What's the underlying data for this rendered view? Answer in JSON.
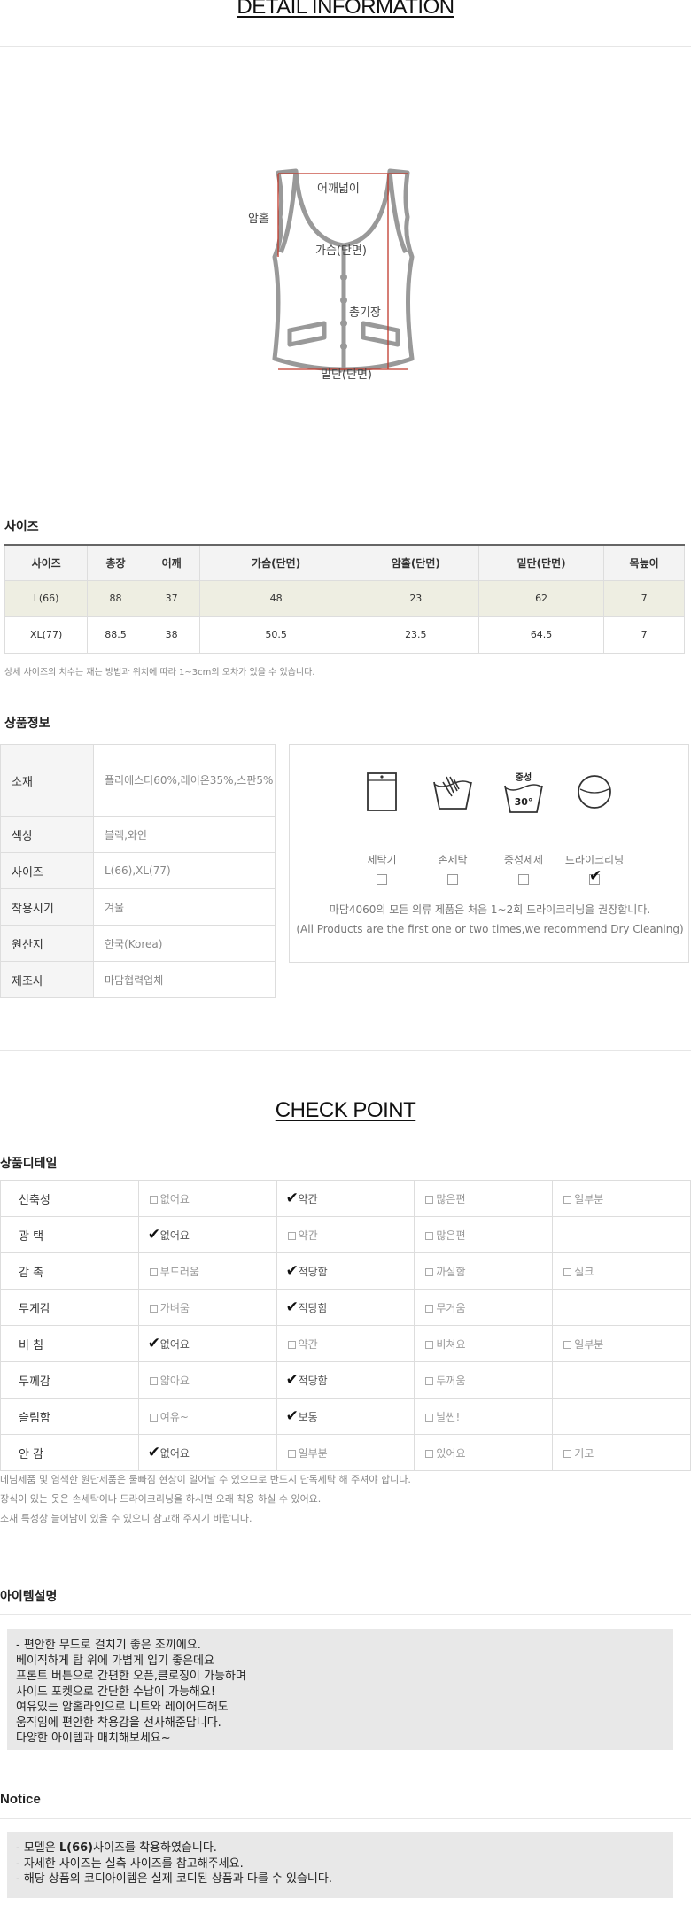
{
  "detail": {
    "title": "DETAIL INFORMATION",
    "diagram_labels": {
      "shoulder": "어깨넓이",
      "armhole": "암홀",
      "chest": "가슴(단면)",
      "length": "총기장",
      "hem": "밑단(단면)"
    }
  },
  "size": {
    "heading": "사이즈",
    "columns": [
      "사이즈",
      "총장",
      "어깨",
      "가슴(단면)",
      "암홀(단면)",
      "밑단(단면)",
      "목높이"
    ],
    "rows": [
      [
        "L(66)",
        "88",
        "37",
        "48",
        "23",
        "62",
        "7"
      ],
      [
        "XL(77)",
        "88.5",
        "38",
        "50.5",
        "23.5",
        "64.5",
        "7"
      ]
    ],
    "note": "상세 사이즈의 치수는 재는 방법과 위치에 따라 1~3cm의 오차가 있을 수 있습니다."
  },
  "product_info": {
    "heading": "상품정보",
    "rows": [
      {
        "key": "소재",
        "value": "폴리에스터60%,레이온35%,스판5%"
      },
      {
        "key": "색상",
        "value": "블랙,와인"
      },
      {
        "key": "사이즈",
        "value": "L(66),XL(77)"
      },
      {
        "key": "착용시기",
        "value": "겨울"
      },
      {
        "key": "원산지",
        "value": "한국(Korea)"
      },
      {
        "key": "제조사",
        "value": "마담협력업체"
      }
    ]
  },
  "care": {
    "items": [
      {
        "label": "세탁기",
        "icon": "washing-machine-icon",
        "checked": false
      },
      {
        "label": "손세탁",
        "icon": "hand-wash-icon",
        "checked": false
      },
      {
        "label": "중성세제",
        "icon": "neutral-detergent-icon",
        "badge_top": "중성",
        "badge_bottom": "30°",
        "checked": false
      },
      {
        "label": "드라이크리닝",
        "icon": "dry-cleaning-icon",
        "checked": true
      }
    ],
    "note_ko": "마담4060의 모든 의류 제품은 처음 1~2회 드라이크리닝을 권장합니다.",
    "note_en": "(All Products are the first one or two times,we recommend Dry Cleaning)"
  },
  "check_point": {
    "title": "CHECK POINT",
    "heading": "상품디테일",
    "rows": [
      {
        "key": "신축성",
        "options": [
          {
            "t": "없어요",
            "on": false
          },
          {
            "t": "약간",
            "on": true
          },
          {
            "t": "많은편",
            "on": false
          },
          {
            "t": "일부분",
            "on": false
          }
        ]
      },
      {
        "key": "광 택",
        "options": [
          {
            "t": "없어요",
            "on": true
          },
          {
            "t": "약간",
            "on": false
          },
          {
            "t": "많은편",
            "on": false
          }
        ]
      },
      {
        "key": "감 촉",
        "options": [
          {
            "t": "부드러움",
            "on": false
          },
          {
            "t": "적당함",
            "on": true
          },
          {
            "t": "까실함",
            "on": false
          },
          {
            "t": "실크",
            "on": false
          }
        ]
      },
      {
        "key": "무게감",
        "options": [
          {
            "t": "가벼움",
            "on": false
          },
          {
            "t": "적당함",
            "on": true
          },
          {
            "t": "무거움",
            "on": false
          }
        ]
      },
      {
        "key": "비 침",
        "options": [
          {
            "t": "없어요",
            "on": true
          },
          {
            "t": "약간",
            "on": false
          },
          {
            "t": "비쳐요",
            "on": false
          },
          {
            "t": "일부분",
            "on": false
          }
        ]
      },
      {
        "key": "두께감",
        "options": [
          {
            "t": "얇아요",
            "on": false
          },
          {
            "t": "적당함",
            "on": true
          },
          {
            "t": "두꺼움",
            "on": false
          }
        ]
      },
      {
        "key": "슬림함",
        "options": [
          {
            "t": "여유~",
            "on": false
          },
          {
            "t": "보통",
            "on": true
          },
          {
            "t": "날씬!",
            "on": false
          }
        ]
      },
      {
        "key": "안 감",
        "options": [
          {
            "t": "없어요",
            "on": true
          },
          {
            "t": "일부분",
            "on": false
          },
          {
            "t": "있어요",
            "on": false
          },
          {
            "t": "기모",
            "on": false
          }
        ]
      }
    ],
    "notes": [
      "데님제품 및 염색한 원단제품은 물빠짐 현상이 일어날 수 있으므로 반드시 단독세탁 해 주셔야 합니다.",
      "장식이 있는 옷은 손세탁이나 드라이크리닝을 하시면 오래 착용 하실 수 있어요.",
      "소재 특성상 늘어남이 있을 수 있으니 참고해 주시기 바랍니다."
    ]
  },
  "item_desc": {
    "heading": "아이템설명",
    "lines": [
      "- 편안한 무드로 걸치기 좋은 조끼에요.",
      "베이직하게 탑 위에 가볍게 입기 좋은데요",
      "프론트 버튼으로 간편한 오픈,클로징이 가능하며",
      "사이드 포켓으로 간단한 수납이 가능해요!",
      "여유있는 암홀라인으로 니트와 레이어드해도",
      "움직임에 편안한 착용감을 선사해준답니다.",
      "다양한 아이템과 매치해보세요~"
    ]
  },
  "notice": {
    "heading": "Notice",
    "line1_pre": "- 모델은 ",
    "line1_bold": "L(66)",
    "line1_post": "사이즈를 착용하였습니다.",
    "line2": "- 자세한 사이즈는 실측 사이즈를 참고해주세요.",
    "line3": "- 해당 상품의 코디아이템은 실제 코디된 상품과 다를 수 있습니다."
  }
}
